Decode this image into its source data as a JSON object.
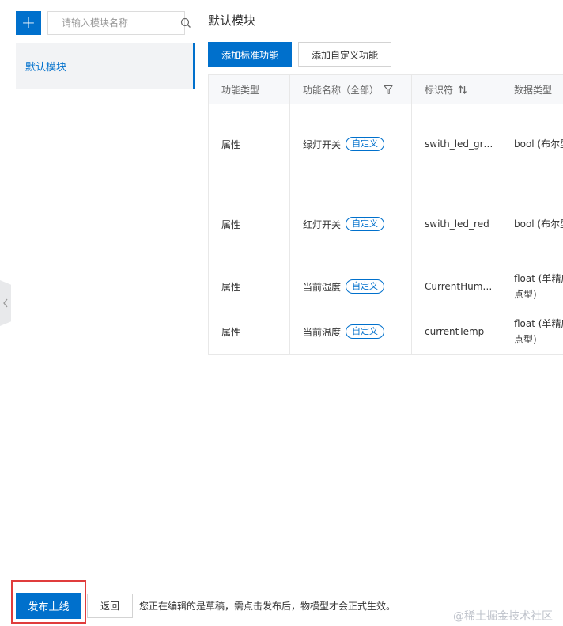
{
  "sidebar": {
    "add_button_glyph": "+",
    "search": {
      "placeholder": "请输入模块名称",
      "value": ""
    },
    "modules": [
      {
        "label": "默认模块",
        "active": true
      }
    ]
  },
  "main": {
    "title": "默认模块",
    "add_standard_label": "添加标准功能",
    "add_custom_label": "添加自定义功能",
    "table": {
      "headers": {
        "type": "功能类型",
        "name": "功能名称（全部）",
        "identifier": "标识符",
        "datatype": "数据类型"
      },
      "rows": [
        {
          "type": "属性",
          "name": "绿灯开关",
          "tag": "自定义",
          "identifier": "swith_led_gre...",
          "datatype_line1": "bool (布尔型)",
          "datatype_line2": ""
        },
        {
          "type": "属性",
          "name": "红灯开关",
          "tag": "自定义",
          "identifier": "swith_led_red",
          "datatype_line1": "bool (布尔型)",
          "datatype_line2": ""
        },
        {
          "type": "属性",
          "name": "当前湿度",
          "tag": "自定义",
          "identifier": "CurrentHumi...",
          "datatype_line1": "float (单精度浮",
          "datatype_line2": "点型)"
        },
        {
          "type": "属性",
          "name": "当前温度",
          "tag": "自定义",
          "identifier": "currentTemp",
          "datatype_line1": "float (单精度浮",
          "datatype_line2": "点型)"
        }
      ]
    }
  },
  "footer": {
    "publish_label": "发布上线",
    "back_label": "返回",
    "note": "您正在编辑的是草稿，需点击发布后，物模型才会正式生效。"
  },
  "watermark": "@稀土掘金技术社区",
  "colors": {
    "primary": "#0070cc",
    "highlight_border": "#e03c3c",
    "header_bg": "#f7f8fa"
  }
}
